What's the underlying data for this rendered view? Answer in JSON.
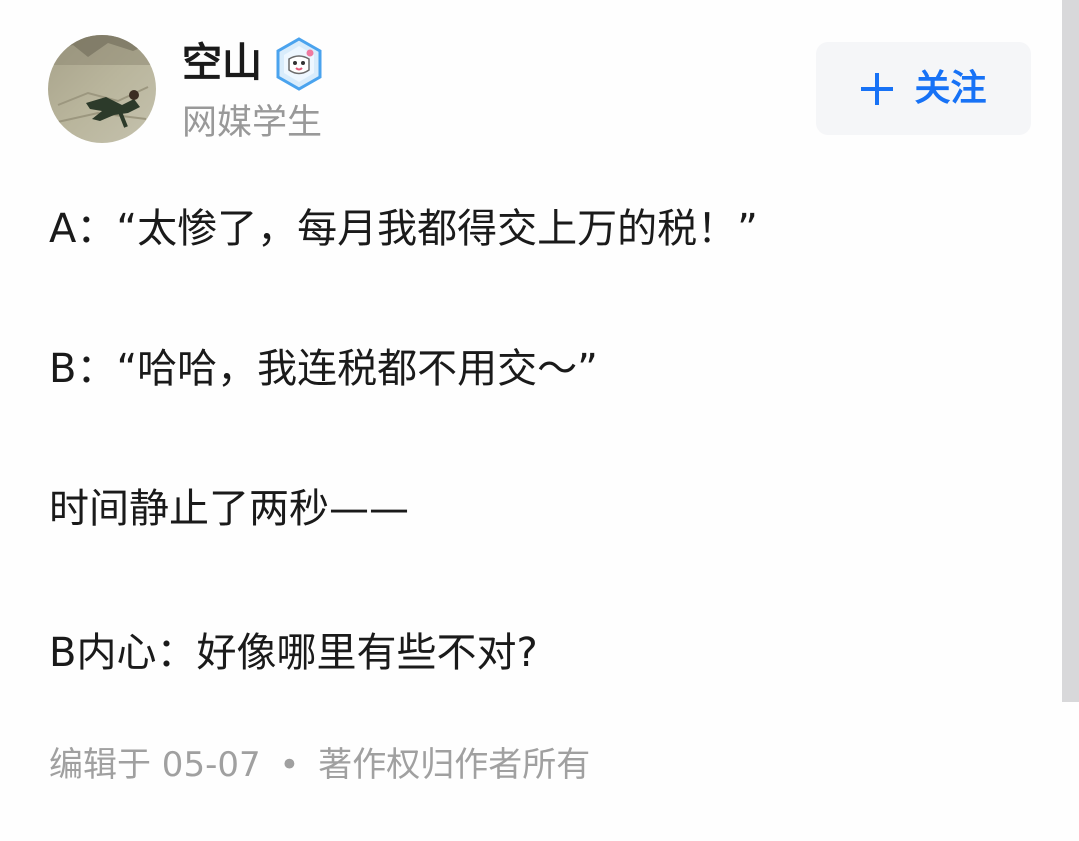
{
  "author": {
    "name": "空山",
    "bio": "网媒学生",
    "avatar_icon": "avatar-image",
    "badge_icon": "verified-badge-icon"
  },
  "follow_button": {
    "icon": "plus-icon",
    "label": "关注",
    "color": "#1772f6"
  },
  "content": {
    "lines": [
      "A：“太惨了，每月我都得交上万的税！”",
      "B：“哈哈，我连税都不用交～”",
      "时间静止了两秒——",
      "B内心：好像哪里有些不对?"
    ]
  },
  "meta": {
    "edited": "编辑于 05-07",
    "separator": "•",
    "copyright": "著作权归作者所有"
  }
}
